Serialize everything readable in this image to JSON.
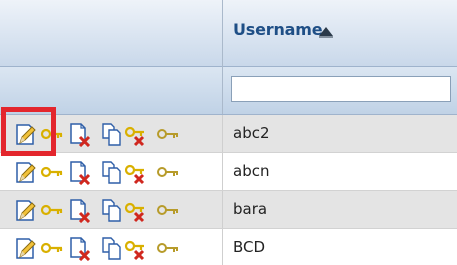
{
  "grid": {
    "column_header": "Username",
    "sort_icon": "sort-ascending-icon",
    "filter_value": "",
    "row_action_icons": [
      "edit-icon",
      "key-icon",
      "delete-document-icon",
      "copy-icon",
      "delete-key-icon",
      "key-icon"
    ],
    "rows": [
      {
        "username": "abc2"
      },
      {
        "username": "abcn"
      },
      {
        "username": "bara"
      },
      {
        "username": "BCD"
      }
    ]
  },
  "colors": {
    "header_text": "#1f4f86",
    "highlight_border": "#e3262d",
    "key_yellow": "#e0b800",
    "delete_red": "#d0281f"
  }
}
